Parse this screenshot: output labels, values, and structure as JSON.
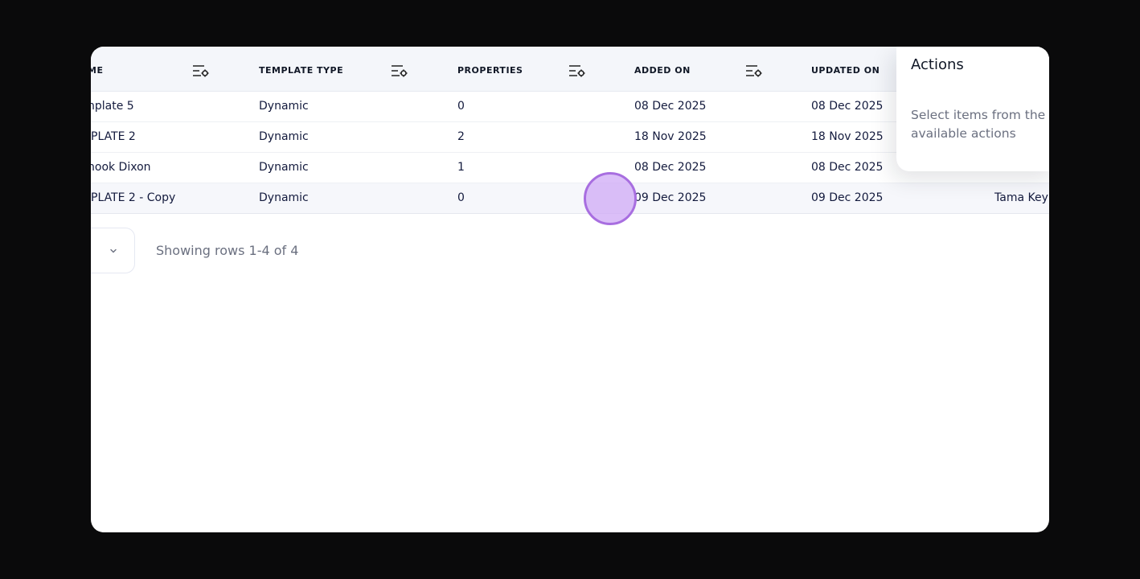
{
  "table": {
    "columns": [
      {
        "label": "ME"
      },
      {
        "label": "TEMPLATE TYPE"
      },
      {
        "label": "PROPERTIES"
      },
      {
        "label": "ADDED ON"
      },
      {
        "label": "UPDATED ON"
      }
    ],
    "rows": [
      {
        "name": "nplate 5",
        "template_type": "Dynamic",
        "properties": "0",
        "added_on": "08 Dec 2025",
        "updated_on": "08 Dec 2025",
        "extra": ""
      },
      {
        "name": "PLATE 2",
        "template_type": "Dynamic",
        "properties": "2",
        "added_on": "18 Nov 2025",
        "updated_on": "18 Nov 2025",
        "extra": ""
      },
      {
        "name": "hook Dixon",
        "template_type": "Dynamic",
        "properties": "1",
        "added_on": "08 Dec 2025",
        "updated_on": "08 Dec 2025",
        "extra": ""
      },
      {
        "name": "PLATE 2 - Copy",
        "template_type": "Dynamic",
        "properties": "0",
        "added_on": "09 Dec 2025",
        "updated_on": "09 Dec 2025",
        "extra": "Tama Key"
      }
    ],
    "column_settings_icon": "filter-settings-icon"
  },
  "pagination": {
    "dropdown_icon": "chevron-down-icon",
    "summary": "Showing rows 1-4 of 4"
  },
  "actions_panel": {
    "title": "Actions",
    "description": "Select items from the\navailable actions"
  },
  "colors": {
    "header_bg": "#f4f6fa",
    "text_dark": "#131a3d",
    "muted": "#6b7080",
    "cursor_fill": "#cfaaf5",
    "cursor_border": "#a86ee0"
  }
}
